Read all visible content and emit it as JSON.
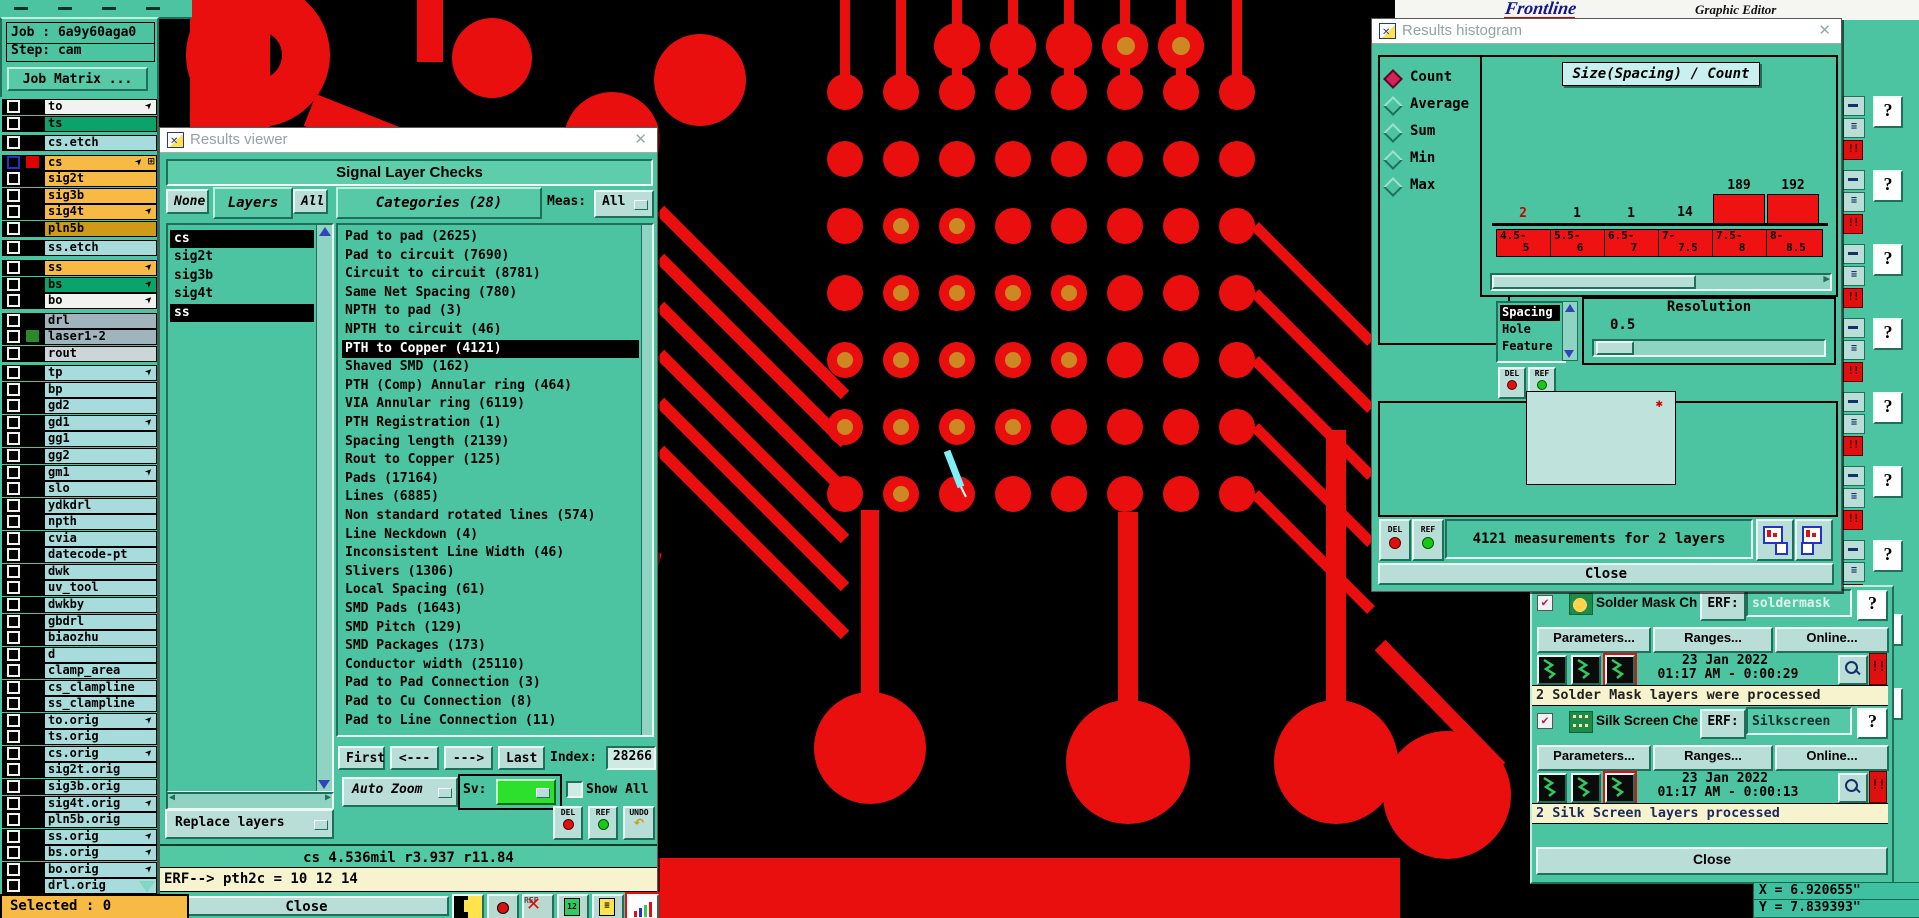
{
  "app": {
    "brand": "Frontline",
    "brand_sub": "Graphic Editor"
  },
  "job_panel": {
    "job": "Job : 6a9y60aga0",
    "step": "Step: cam",
    "matrix_button": "Job Matrix ..."
  },
  "sidebar": {
    "selected": "Selected : 0",
    "layers": [
      {
        "name": "to",
        "bg": "white",
        "arrow": true
      },
      {
        "name": "ts",
        "bg": "green"
      },
      {
        "name": "cs.etch",
        "bg": "cyan",
        "gap": true
      },
      {
        "name": "cs",
        "bg": "orange",
        "arrow": true,
        "chip": "#e00000",
        "extra": true,
        "gap": true
      },
      {
        "name": "sig2t",
        "bg": "orange"
      },
      {
        "name": "sig3b",
        "bg": "orange"
      },
      {
        "name": "sig4t",
        "bg": "orange",
        "arrow": true
      },
      {
        "name": "pln5b",
        "bg": "gold"
      },
      {
        "name": "ss.etch",
        "bg": "cyan",
        "gap": true
      },
      {
        "name": "ss",
        "bg": "orange",
        "arrow": true,
        "gap": true
      },
      {
        "name": "bs",
        "bg": "green",
        "arrow": true
      },
      {
        "name": "bo",
        "bg": "white",
        "arrow": true
      },
      {
        "name": "drl",
        "bg": "gray",
        "gap": true
      },
      {
        "name": "laser1-2",
        "bg": "gray",
        "chip": "#2a8a2a"
      },
      {
        "name": "rout",
        "bg": "lightgray"
      },
      {
        "name": "tp",
        "bg": "cyan",
        "arrow": true,
        "gap": true
      },
      {
        "name": "bp",
        "bg": "cyan"
      },
      {
        "name": "gd2",
        "bg": "cyan"
      },
      {
        "name": "gd1",
        "bg": "cyan",
        "arrow": true
      },
      {
        "name": "gg1",
        "bg": "cyan"
      },
      {
        "name": "gg2",
        "bg": "cyan"
      },
      {
        "name": "gm1",
        "bg": "cyan",
        "arrow": true
      },
      {
        "name": "slo",
        "bg": "cyan"
      },
      {
        "name": "ydkdrl",
        "bg": "cyan"
      },
      {
        "name": "npth",
        "bg": "cyan"
      },
      {
        "name": "cvia",
        "bg": "cyan"
      },
      {
        "name": "datecode-pt",
        "bg": "cyan"
      },
      {
        "name": "dwk",
        "bg": "cyan"
      },
      {
        "name": "uv_tool",
        "bg": "cyan"
      },
      {
        "name": "dwkby",
        "bg": "cyan"
      },
      {
        "name": "gbdrl",
        "bg": "cyan"
      },
      {
        "name": "biaozhu",
        "bg": "cyan"
      },
      {
        "name": "d",
        "bg": "cyan"
      },
      {
        "name": "clamp_area",
        "bg": "cyan"
      },
      {
        "name": "cs_clampline",
        "bg": "cyan"
      },
      {
        "name": "ss_clampline",
        "bg": "cyan"
      },
      {
        "name": "to.orig",
        "bg": "cyan",
        "arrow": true
      },
      {
        "name": "ts.orig",
        "bg": "cyan"
      },
      {
        "name": "cs.orig",
        "bg": "cyan",
        "arrow": true
      },
      {
        "name": "sig2t.orig",
        "bg": "cyan"
      },
      {
        "name": "sig3b.orig",
        "bg": "cyan"
      },
      {
        "name": "sig4t.orig",
        "bg": "cyan",
        "arrow": true
      },
      {
        "name": "pln5b.orig",
        "bg": "cyan"
      },
      {
        "name": "ss.orig",
        "bg": "cyan",
        "arrow": true
      },
      {
        "name": "bs.orig",
        "bg": "cyan",
        "arrow": true
      },
      {
        "name": "bo.orig",
        "bg": "cyan",
        "arrow": true
      },
      {
        "name": "drl.orig",
        "bg": "cyan"
      }
    ]
  },
  "viewer": {
    "title": "Results viewer",
    "header": "Signal Layer Checks",
    "filter_buttons": {
      "none": "None",
      "layers": "Layers",
      "all": "All"
    },
    "categories_header": "Categories (28)",
    "meas_label": "Meas:",
    "meas_value": "All",
    "layer_list": [
      {
        "name": "cs",
        "selected": true
      },
      {
        "name": "sig2t"
      },
      {
        "name": "sig3b"
      },
      {
        "name": "sig4t"
      },
      {
        "name": "ss",
        "selected": true
      }
    ],
    "categories": [
      "Pad to pad (2625)",
      "Pad to circuit (7690)",
      "Circuit to circuit (8781)",
      "Same Net Spacing (780)",
      "NPTH to pad (3)",
      "NPTH to circuit (46)",
      "PTH to Copper (4121)",
      "Shaved SMD (162)",
      "PTH (Comp) Annular ring (464)",
      "VIA Annular ring (6119)",
      "PTH Registration (1)",
      "Spacing length (2139)",
      "Rout to Copper (125)",
      "Pads (17164)",
      "Lines (6885)",
      "Non standard rotated lines (574)",
      "Line Neckdown (4)",
      "Inconsistent Line Width (46)",
      "Slivers (1306)",
      "Local Spacing (61)",
      "SMD Pads (1643)",
      "SMD Pitch (129)",
      "SMD Packages (173)",
      "Conductor width (25110)",
      "Pad to Pad Connection (3)",
      "Pad to Cu Connection (8)",
      "Pad to Line Connection (11)"
    ],
    "selected_category_index": 6,
    "nav": {
      "first": "First",
      "prev": "<---",
      "next": "--->",
      "last": "Last",
      "index_label": "Index:",
      "index_value": "28266"
    },
    "auto_zoom": "Auto Zoom",
    "sv_label": "Sv:",
    "show_all": "Show All",
    "replace_layers": "Replace layers",
    "tools": {
      "del": "DEL",
      "ref": "REF",
      "undo": "UNDO"
    },
    "status_line": "cs 4.536mil  r3.937  r11.84",
    "erf_line": "ERF--> pth2c = 10 12 14",
    "close": "Close"
  },
  "histogram": {
    "title": "Results histogram",
    "stats": [
      {
        "label": "Count",
        "selected": true
      },
      {
        "label": "Average"
      },
      {
        "label": "Sum"
      },
      {
        "label": "Min"
      },
      {
        "label": "Max"
      }
    ],
    "chart_title": "Size(Spacing) / Count",
    "measure_list": [
      {
        "label": "Spacing",
        "selected": true
      },
      {
        "label": "Hole"
      },
      {
        "label": "Feature"
      }
    ],
    "resolution_label": "Resolution",
    "resolution_value": "0.5",
    "del": "DEL",
    "ref": "REF",
    "summary": "4121 measurements for 2 layers",
    "close": "Close"
  },
  "chart_data": {
    "type": "bar",
    "categories": [
      "4.5-5",
      "5.5-6",
      "6.5-7",
      "7-7.5",
      "7.5-8",
      "8-8.5"
    ],
    "values": [
      2,
      1,
      1,
      14,
      189,
      192
    ],
    "title": "Size(Spacing) / Count",
    "highlighted_value_index": 0,
    "bar_color": "#ee1212",
    "ylim": [
      0,
      192
    ]
  },
  "checklist": {
    "sections": [
      {
        "name": "Solder Mask Ch",
        "erf_label": "ERF:",
        "erf_value": "soldermask",
        "icon": "solder-mask-icon",
        "params": "Parameters...",
        "ranges": "Ranges...",
        "online": "Online...",
        "date": "23 Jan 2022",
        "time": "01:17 AM - 0:00:29",
        "status": "2 Solder Mask layers were processed"
      },
      {
        "name": "Silk Screen Che",
        "erf_label": "ERF:",
        "erf_value": "Silkscreen",
        "icon": "silk-screen-icon",
        "params": "Parameters...",
        "ranges": "Ranges...",
        "online": "Online...",
        "date": "23 Jan 2022",
        "time": "01:17 AM - 0:00:13",
        "status": "2 Silk Screen layers processed"
      }
    ],
    "close": "Close",
    "help": "?",
    "alert": "!!"
  },
  "coords": {
    "x": "X = 6.920655\"",
    "y": "Y = 7.839393\""
  }
}
